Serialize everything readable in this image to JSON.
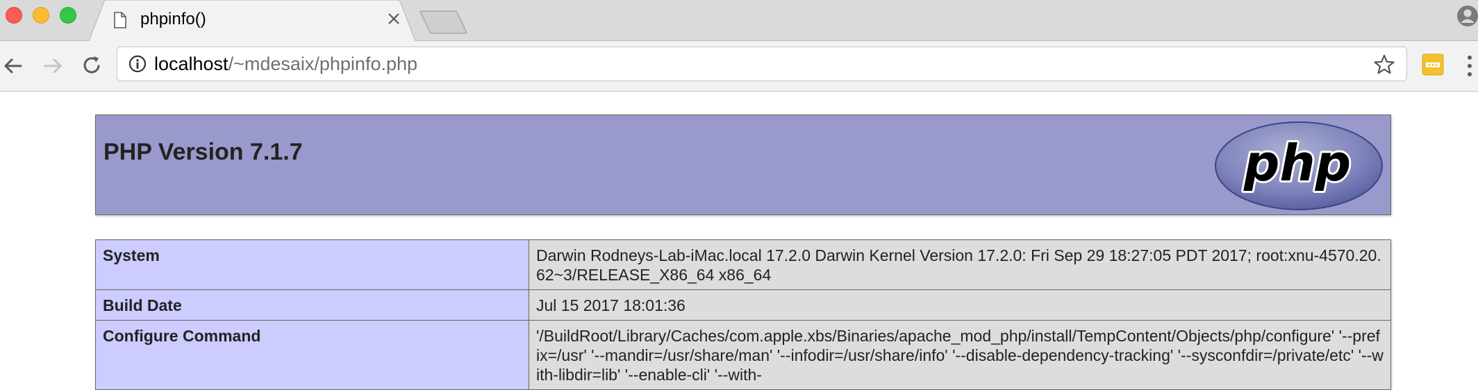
{
  "browser": {
    "tab_title": "phpinfo()",
    "url_host": "localhost",
    "url_path": "/~mdesaix/phpinfo.php",
    "icons": {
      "back": "back-arrow-icon",
      "forward": "forward-arrow-icon",
      "reload": "reload-icon",
      "info": "info-icon",
      "star": "star-icon",
      "extension": "extension-icon",
      "menu": "menu-icon",
      "profile": "profile-icon",
      "close": "close-icon",
      "page": "page-icon"
    }
  },
  "page": {
    "header": {
      "version": "PHP Version 7.1.7",
      "logo_text": "php"
    },
    "rows": [
      {
        "key": "System",
        "value": "Darwin Rodneys-Lab-iMac.local 17.2.0 Darwin Kernel Version 17.2.0: Fri Sep 29 18:27:05 PDT 2017; root:xnu-4570.20.62~3/RELEASE_X86_64 x86_64"
      },
      {
        "key": "Build Date",
        "value": "Jul 15 2017 18:01:36"
      },
      {
        "key": "Configure Command",
        "value": "'/BuildRoot/Library/Caches/com.apple.xbs/Binaries/apache_mod_php/install/TempContent/Objects/php/configure' '--prefix=/usr' '--mandir=/usr/share/man' '--infodir=/usr/share/info' '--disable-dependency-tracking' '--sysconfdir=/private/etc' '--with-libdir=lib' '--enable-cli' '--with-"
      }
    ]
  },
  "colors": {
    "header_bg": "#9999cc",
    "key_cell_bg": "#ccccff",
    "value_cell_bg": "#dddddd",
    "border": "#666666"
  }
}
